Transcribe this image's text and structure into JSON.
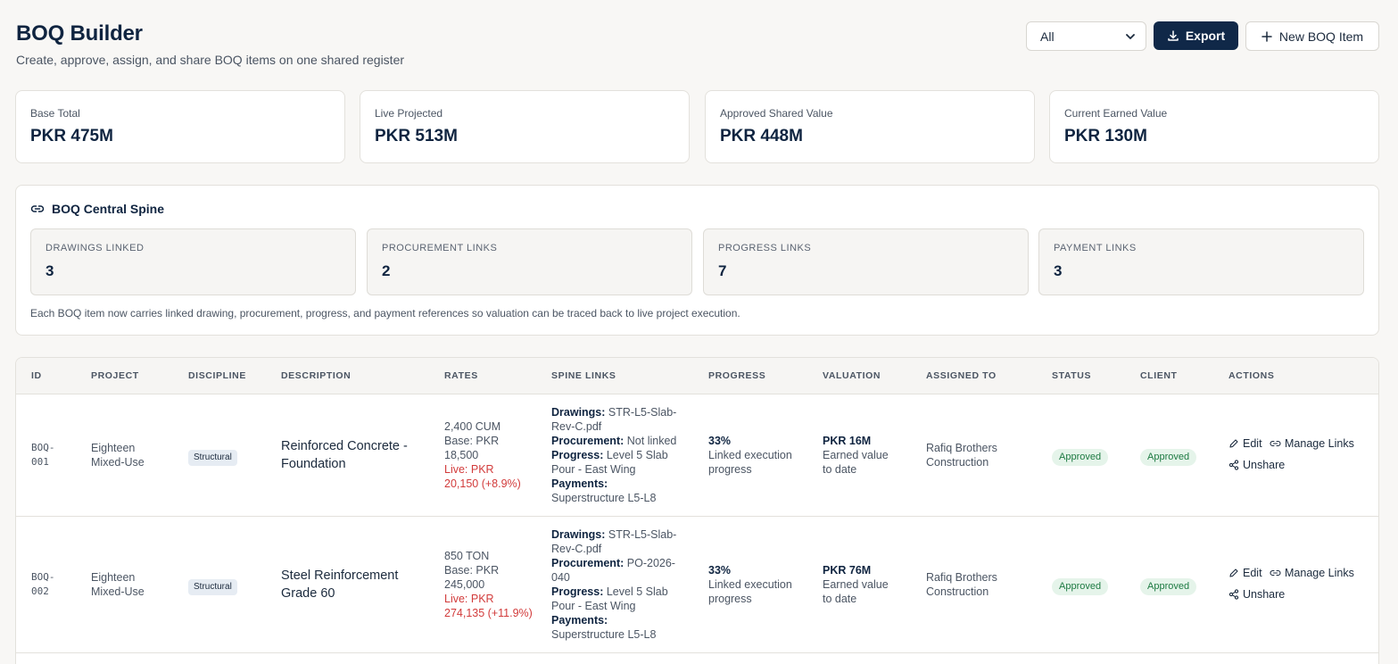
{
  "header": {
    "title": "BOQ Builder",
    "subtitle": "Create, approve, assign, and share BOQ items on one shared register",
    "filter_value": "All",
    "export_label": "Export",
    "new_label": "New BOQ Item"
  },
  "kpis": [
    {
      "label": "Base Total",
      "value": "PKR 475M"
    },
    {
      "label": "Live Projected",
      "value": "PKR 513M"
    },
    {
      "label": "Approved Shared Value",
      "value": "PKR 448M"
    },
    {
      "label": "Current Earned Value",
      "value": "PKR 130M"
    }
  ],
  "spine": {
    "title": "BOQ Central Spine",
    "cards": [
      {
        "label": "Drawings Linked",
        "value": "3"
      },
      {
        "label": "Procurement Links",
        "value": "2"
      },
      {
        "label": "Progress Links",
        "value": "7"
      },
      {
        "label": "Payment Links",
        "value": "3"
      }
    ],
    "note": "Each BOQ item now carries linked drawing, procurement, progress, and payment references so valuation can be traced back to live project execution."
  },
  "table": {
    "columns": [
      "ID",
      "Project",
      "Discipline",
      "Description",
      "Rates",
      "Spine Links",
      "Progress",
      "Valuation",
      "Assigned To",
      "Status",
      "Client",
      "Actions"
    ],
    "rows": [
      {
        "id_1": "BOQ-",
        "id_2": "001",
        "project_1": "Eighteen",
        "project_2": "Mixed-Use",
        "discipline": "Structural",
        "desc_1": "Reinforced Concrete -",
        "desc_2": "Foundation",
        "rate_qty": "2,400 CUM",
        "rate_base_1": "Base: PKR",
        "rate_base_2": "18,500",
        "rate_live_1": "Live: PKR",
        "rate_live_2": "20,150 (+8.9%)",
        "drawings_label": "Drawings:",
        "drawings_1": "STR-L5-Slab-",
        "drawings_2": "Rev-C.pdf",
        "procurement_label": "Procurement:",
        "procurement_1": "Not linked",
        "procurement_2": "",
        "progress_label": "Progress:",
        "progress_link_1": "Level 5 Slab",
        "progress_link_2": "Pour - East Wing",
        "payments_label": "Payments:",
        "payments_1": "Superstructure L5-L8",
        "progress_pct": "33%",
        "progress_note_1": "Linked execution",
        "progress_note_2": "progress",
        "valuation": "PKR 16M",
        "valuation_note_1": "Earned value",
        "valuation_note_2": "to date",
        "assigned_1": "Rafiq Brothers",
        "assigned_2": "Construction",
        "status": "Approved",
        "client": "Approved",
        "edit": "Edit",
        "manage": "Manage Links",
        "unshare": "Unshare"
      },
      {
        "id_1": "BOQ-",
        "id_2": "002",
        "project_1": "Eighteen",
        "project_2": "Mixed-Use",
        "discipline": "Structural",
        "desc_1": "Steel Reinforcement",
        "desc_2": "Grade 60",
        "rate_qty": "850 TON",
        "rate_base_1": "Base: PKR",
        "rate_base_2": "245,000",
        "rate_live_1": "Live: PKR",
        "rate_live_2": "274,135 (+11.9%)",
        "drawings_label": "Drawings:",
        "drawings_1": "STR-L5-Slab-",
        "drawings_2": "Rev-C.pdf",
        "procurement_label": "Procurement:",
        "procurement_1": "PO-2026-",
        "procurement_2": "040",
        "progress_label": "Progress:",
        "progress_link_1": "Level 5 Slab",
        "progress_link_2": "Pour - East Wing",
        "payments_label": "Payments:",
        "payments_1": "Superstructure L5-L8",
        "progress_pct": "33%",
        "progress_note_1": "Linked execution",
        "progress_note_2": "progress",
        "valuation": "PKR 76M",
        "valuation_note_1": "Earned value",
        "valuation_note_2": "to date",
        "assigned_1": "Rafiq Brothers",
        "assigned_2": "Construction",
        "status": "Approved",
        "client": "Approved",
        "edit": "Edit",
        "manage": "Manage Links",
        "unshare": "Unshare"
      }
    ]
  }
}
